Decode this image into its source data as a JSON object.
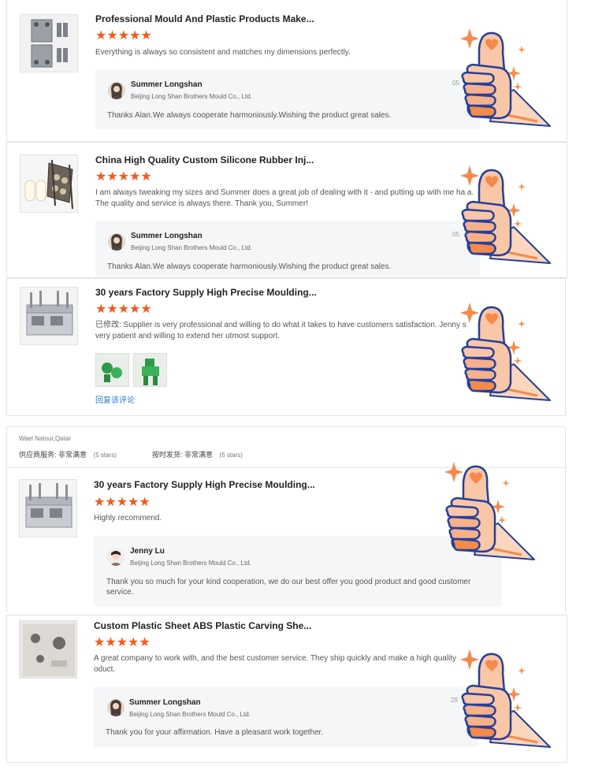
{
  "reviews": [
    {
      "title": "Professional Mould And Plastic Products Make...",
      "stars": "★★★★★",
      "comment": "Everything is always so consistent and matches my dimensions perfectly.",
      "reply": {
        "name": "Summer Longshan",
        "company": "Beijing Long Shan Brothers Mould Co., Ltd.",
        "date": "05",
        "text": "Thanks Alan.We always cooperate harmoniously.Wishing the product great sales."
      }
    },
    {
      "title": "China High Quality Custom Silicone Rubber Inj...",
      "stars": "★★★★★",
      "comment": "I am always tweaking my sizes and Summer does a great job of dealing with it - and putting up with me ha a.  The quality and service is always there.  Thank you, Summer!",
      "reply": {
        "name": "Summer Longshan",
        "company": "Beijing Long Shan Brothers Mould Co., Ltd.",
        "date": "05",
        "text": "Thanks Alan.We always cooperate harmoniously.Wishing the product great sales."
      }
    },
    {
      "title": "30 years Factory Supply High Precise Moulding...",
      "stars": "★★★★★",
      "comment": "已修改: Supplier is very professional and willing to do what it takes to have customers satisfaction. Jenny s very patient and willing to extend her utmost support.",
      "link": "回复该评论"
    },
    {
      "title": "30 years Factory Supply High Precise Moulding...",
      "stars": "★★★★★",
      "comment": "Highly recommend.",
      "reply": {
        "name": "Jenny Lu",
        "company": "Beijing Long Shan Brothers Mould Co., Ltd.",
        "text": "Thank you so much for your kind cooperation, we do our best offer you good product and good customer service."
      }
    },
    {
      "title": "Custom Plastic Sheet ABS Plastic Carving She...",
      "stars": "★★★★★",
      "comment": "A great company to work with, and the best customer service. They ship quickly and make a high quality oduct.",
      "reply": {
        "name": "Summer Longshan",
        "company": "Beijing Long Shan Brothers Mould Co., Ltd.",
        "date": "29",
        "text": "Thank you for your affirmation. Have a pleasant work together."
      }
    }
  ],
  "buyer": {
    "location": "Wael Natour,Qatar",
    "service_label": "供应商服务: 非常满意",
    "service_stars": "(5 stars)",
    "delivery_label": "按时发货: 非常满意",
    "delivery_stars": "(5 stars)"
  },
  "colors": {
    "star": "#f5591c",
    "link": "#2a7ad2",
    "thumb_fill": "#f9c6a8",
    "thumb_stroke": "#23409b"
  }
}
